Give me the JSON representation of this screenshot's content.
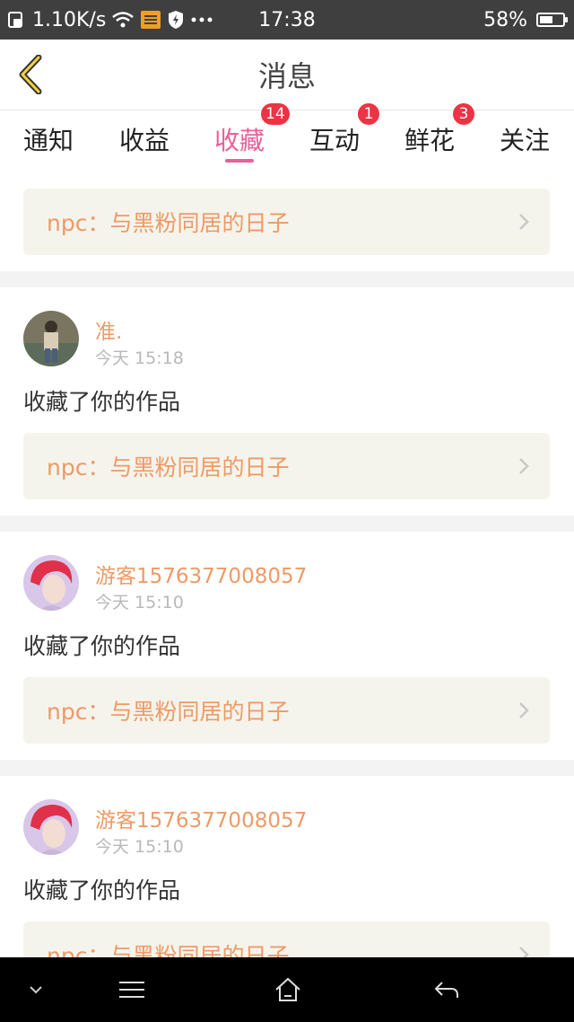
{
  "status_bar": {
    "net_speed": "1.10K/s",
    "time": "17:38",
    "battery": "58%",
    "battery_level": 0.58
  },
  "header": {
    "title": "消息"
  },
  "tabs": [
    {
      "label": "通知",
      "badge": ""
    },
    {
      "label": "收益",
      "badge": ""
    },
    {
      "label": "收藏",
      "badge": "14",
      "active": true
    },
    {
      "label": "互动",
      "badge": "1"
    },
    {
      "label": "鲜花",
      "badge": "3"
    },
    {
      "label": "关注",
      "badge": ""
    }
  ],
  "top_work": {
    "title": "npc：与黑粉同居的日子"
  },
  "messages": [
    {
      "user": "准.",
      "time": "今天 15:18",
      "action": "收藏了你的作品",
      "work": "npc：与黑粉同居的日子"
    },
    {
      "user": "游客1576377008057",
      "time": "今天 15:10",
      "action": "收藏了你的作品",
      "work": "npc：与黑粉同居的日子"
    },
    {
      "user": "游客1576377008057",
      "time": "今天 15:10",
      "action": "收藏了你的作品",
      "work": "npc：与黑粉同居的日子"
    }
  ],
  "colors": {
    "accent_pink": "#e9609a",
    "orange_text": "#ee9a66",
    "badge_red": "#ee3344",
    "card_bg": "#f5f4ec"
  }
}
